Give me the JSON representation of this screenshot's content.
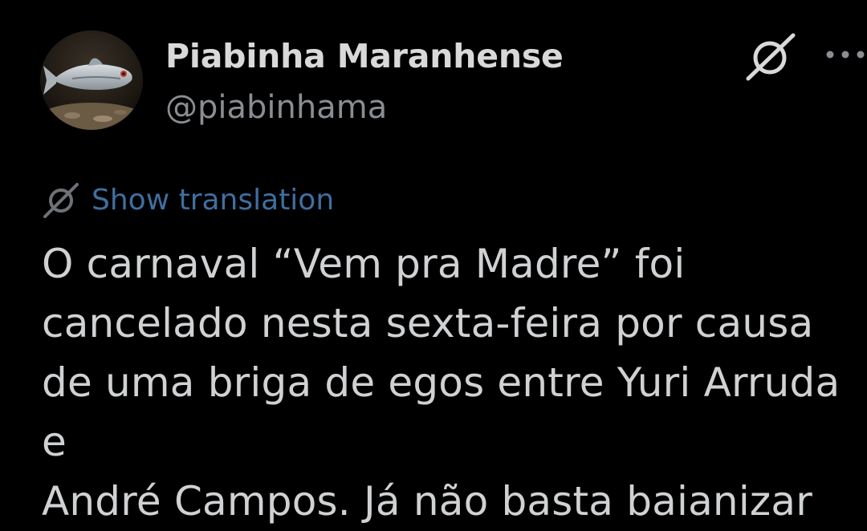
{
  "tweet": {
    "author": {
      "display_name": "Piabinha Maranhense",
      "handle": "@piabinhama",
      "avatar_icon": "fish-avatar"
    },
    "header_icons": {
      "grok": "grok-icon",
      "more": "more-options-icon"
    },
    "translation": {
      "icon": "grok-icon",
      "label": "Show translation"
    },
    "text": "O carnaval “Vem pra Madre” foi\ncancelado nesta sexta-feira por causa\nde uma briga de egos entre Yuri Arruda e\nAndré Campos. Já não basta baianizar"
  },
  "colors": {
    "background": "#000000",
    "display_name": "#d9d9d9",
    "handle": "#8a8d91",
    "link": "#3f6fa0",
    "body_text": "#cfd1d3"
  }
}
